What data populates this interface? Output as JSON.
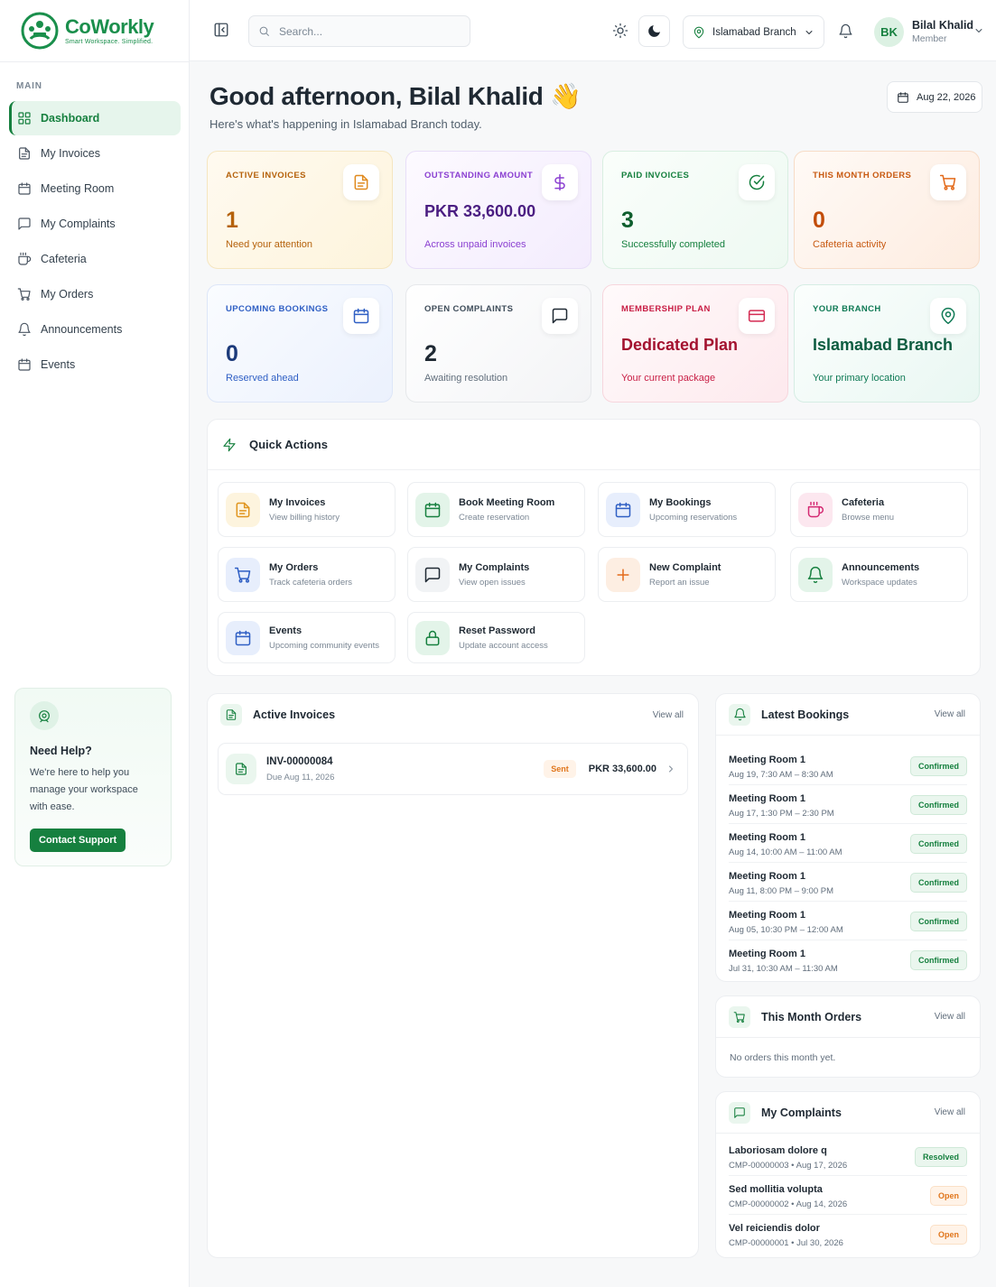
{
  "brand": {
    "name": "CoWorkly",
    "tagline": "Smart Workspace. Simplified.",
    "accent": "#16803f"
  },
  "sidebar": {
    "section": "MAIN",
    "items": [
      {
        "label": "Dashboard",
        "icon": "dashboard-icon",
        "active": true
      },
      {
        "label": "My Invoices",
        "icon": "file-icon"
      },
      {
        "label": "Meeting Room",
        "icon": "calendar-icon"
      },
      {
        "label": "My Complaints",
        "icon": "message-icon"
      },
      {
        "label": "Cafeteria",
        "icon": "coffee-icon"
      },
      {
        "label": "My Orders",
        "icon": "cart-icon"
      },
      {
        "label": "Announcements",
        "icon": "bell-icon"
      },
      {
        "label": "Events",
        "icon": "calendar-icon"
      }
    ],
    "help": {
      "title": "Need Help?",
      "text": "We're here to help you manage your workspace with ease.",
      "button": "Contact Support"
    }
  },
  "topbar": {
    "search_placeholder": "Search...",
    "branch": "Islamabad Branch",
    "user": {
      "initials": "BK",
      "name": "Bilal Khalid",
      "role": "Member"
    }
  },
  "greeting": {
    "title": "Good afternoon, Bilal Khalid 👋",
    "subtitle": "Here's what's happening in Islamabad Branch today.",
    "date": "Aug 22, 2026"
  },
  "stats": [
    {
      "label": "Active Invoices",
      "value": "1",
      "note": "Need your attention",
      "icon": "file-icon"
    },
    {
      "label": "Outstanding Amount",
      "value": "PKR 33,600.00",
      "note": "Across unpaid invoices",
      "icon": "dollar-icon"
    },
    {
      "label": "Paid Invoices",
      "value": "3",
      "note": "Successfully completed",
      "icon": "check-circle-icon"
    },
    {
      "label": "This Month Orders",
      "value": "0",
      "note": "Cafeteria activity",
      "icon": "cart-icon"
    },
    {
      "label": "Upcoming Bookings",
      "value": "0",
      "note": "Reserved ahead",
      "icon": "calendar-icon"
    },
    {
      "label": "Open Complaints",
      "value": "2",
      "note": "Awaiting resolution",
      "icon": "message-icon"
    },
    {
      "label": "Membership Plan",
      "value": "Dedicated Plan",
      "note": "Your current package",
      "icon": "card-icon"
    },
    {
      "label": "Your Branch",
      "value": "Islamabad Branch",
      "note": "Your primary location",
      "icon": "pin-icon"
    }
  ],
  "quick_actions": {
    "title": "Quick Actions",
    "items": [
      {
        "title": "My Invoices",
        "sub": "View billing history",
        "icon": "file-icon"
      },
      {
        "title": "Book Meeting Room",
        "sub": "Create reservation",
        "icon": "calendar-icon"
      },
      {
        "title": "My Bookings",
        "sub": "Upcoming reservations",
        "icon": "calendar-icon"
      },
      {
        "title": "Cafeteria",
        "sub": "Browse menu",
        "icon": "coffee-icon"
      },
      {
        "title": "My Orders",
        "sub": "Track cafeteria orders",
        "icon": "cart-icon"
      },
      {
        "title": "My Complaints",
        "sub": "View open issues",
        "icon": "message-icon"
      },
      {
        "title": "New Complaint",
        "sub": "Report an issue",
        "icon": "plus-icon"
      },
      {
        "title": "Announcements",
        "sub": "Workspace updates",
        "icon": "bell-icon"
      },
      {
        "title": "Events",
        "sub": "Upcoming community events",
        "icon": "calendar-icon"
      },
      {
        "title": "Reset Password",
        "sub": "Update account access",
        "icon": "lock-icon"
      }
    ]
  },
  "active_invoices": {
    "title": "Active Invoices",
    "view_all": "View all",
    "rows": [
      {
        "number": "INV-00000084",
        "due": "Due Aug 11, 2026",
        "status": "Sent",
        "amount": "PKR 33,600.00"
      }
    ]
  },
  "latest_bookings": {
    "title": "Latest Bookings",
    "view_all": "View all",
    "rows": [
      {
        "room": "Meeting Room 1",
        "time": "Aug 19, 7:30 AM – 8:30 AM",
        "status": "Confirmed"
      },
      {
        "room": "Meeting Room 1",
        "time": "Aug 17, 1:30 PM – 2:30 PM",
        "status": "Confirmed"
      },
      {
        "room": "Meeting Room 1",
        "time": "Aug 14, 10:00 AM – 11:00 AM",
        "status": "Confirmed"
      },
      {
        "room": "Meeting Room 1",
        "time": "Aug 11, 8:00 PM – 9:00 PM",
        "status": "Confirmed"
      },
      {
        "room": "Meeting Room 1",
        "time": "Aug 05, 10:30 PM – 12:00 AM",
        "status": "Confirmed"
      },
      {
        "room": "Meeting Room 1",
        "time": "Jul 31, 10:30 AM – 11:30 AM",
        "status": "Confirmed"
      }
    ]
  },
  "month_orders": {
    "title": "This Month Orders",
    "view_all": "View all",
    "empty": "No orders this month yet."
  },
  "complaints": {
    "title": "My Complaints",
    "view_all": "View all",
    "rows": [
      {
        "title": "Laboriosam dolore q",
        "meta": "CMP-00000003 • Aug 17, 2026",
        "status": "Resolved"
      },
      {
        "title": "Sed mollitia volupta",
        "meta": "CMP-00000002 • Aug 14, 2026",
        "status": "Open"
      },
      {
        "title": "Vel reiciendis dolor",
        "meta": "CMP-00000001 • Jul 30, 2026",
        "status": "Open"
      }
    ]
  }
}
